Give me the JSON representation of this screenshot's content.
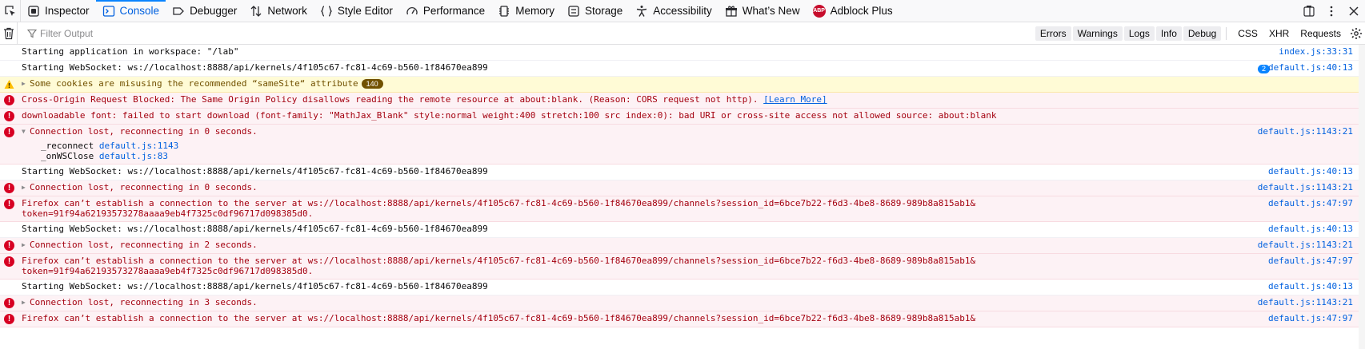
{
  "toolbar": {
    "tabs": [
      {
        "label": "Inspector",
        "icon": "inspector-icon"
      },
      {
        "label": "Console",
        "icon": "console-icon",
        "selected": true
      },
      {
        "label": "Debugger",
        "icon": "debugger-icon"
      },
      {
        "label": "Network",
        "icon": "network-icon"
      },
      {
        "label": "Style Editor",
        "icon": "style-editor-icon"
      },
      {
        "label": "Performance",
        "icon": "performance-icon"
      },
      {
        "label": "Memory",
        "icon": "memory-icon"
      },
      {
        "label": "Storage",
        "icon": "storage-icon"
      },
      {
        "label": "Accessibility",
        "icon": "accessibility-icon"
      },
      {
        "label": "What’s New",
        "icon": "whats-new-icon"
      },
      {
        "label": "Adblock Plus",
        "icon": "adblock-plus-icon"
      }
    ],
    "abp_badge": "ABP"
  },
  "filterbar": {
    "placeholder": "Filter Output",
    "levels": [
      "Errors",
      "Warnings",
      "Logs",
      "Info",
      "Debug"
    ],
    "net_filters": [
      "CSS",
      "XHR",
      "Requests"
    ]
  },
  "messages": [
    {
      "type": "log",
      "text": "Starting application in workspace: \"/lab\"",
      "location": "index.js:33:31"
    },
    {
      "type": "log",
      "text": "Starting WebSocket: ws://localhost:8888/api/kernels/4f105c67-fc81-4c69-b560-1f84670ea899",
      "location": "default.js:40:13",
      "repeat": "2"
    },
    {
      "type": "warn",
      "text": "Some cookies are misusing the recommended “sameSite“ attribute",
      "count": "140"
    },
    {
      "type": "error",
      "text": "Cross-Origin Request Blocked: The Same Origin Policy disallows reading the remote resource at about:blank. (Reason: CORS request not http). ",
      "link": "[Learn More]"
    },
    {
      "type": "error",
      "text": "downloadable font: failed to start download (font-family: \"MathJax_Blank\" style:normal weight:400 stretch:100 src index:0): bad URI or cross-site access not allowed source: about:blank"
    },
    {
      "type": "error",
      "expanded": true,
      "text": "Connection lost, reconnecting in 0 seconds.",
      "location": "default.js:1143:21",
      "stack": [
        {
          "fn": "_reconnect",
          "src": "default.js:1143"
        },
        {
          "fn": "_onWSClose",
          "src": "default.js:83"
        }
      ]
    },
    {
      "type": "log",
      "text": "Starting WebSocket: ws://localhost:8888/api/kernels/4f105c67-fc81-4c69-b560-1f84670ea899",
      "location": "default.js:40:13"
    },
    {
      "type": "error",
      "collapsed": true,
      "text": "Connection lost, reconnecting in 0 seconds.",
      "location": "default.js:1143:21"
    },
    {
      "type": "error",
      "text": "Firefox can’t establish a connection to the server at ws://localhost:8888/api/kernels/4f105c67-fc81-4c69-b560-1f84670ea899/channels?session_id=6bce7b22-f6d3-4be8-8689-989b8a815ab1&\ntoken=91f94a62193573278aaaa9eb4f7325c0df96717d098385d0.",
      "location": "default.js:47:97"
    },
    {
      "type": "log",
      "text": "Starting WebSocket: ws://localhost:8888/api/kernels/4f105c67-fc81-4c69-b560-1f84670ea899",
      "location": "default.js:40:13"
    },
    {
      "type": "error",
      "collapsed": true,
      "text": "Connection lost, reconnecting in 2 seconds.",
      "location": "default.js:1143:21"
    },
    {
      "type": "error",
      "text": "Firefox can’t establish a connection to the server at ws://localhost:8888/api/kernels/4f105c67-fc81-4c69-b560-1f84670ea899/channels?session_id=6bce7b22-f6d3-4be8-8689-989b8a815ab1&\ntoken=91f94a62193573278aaaa9eb4f7325c0df96717d098385d0.",
      "location": "default.js:47:97"
    },
    {
      "type": "log",
      "text": "Starting WebSocket: ws://localhost:8888/api/kernels/4f105c67-fc81-4c69-b560-1f84670ea899",
      "location": "default.js:40:13"
    },
    {
      "type": "error",
      "collapsed": true,
      "text": "Connection lost, reconnecting in 3 seconds.",
      "location": "default.js:1143:21"
    },
    {
      "type": "error",
      "text": "Firefox can’t establish a connection to the server at ws://localhost:8888/api/kernels/4f105c67-fc81-4c69-b560-1f84670ea899/channels?session_id=6bce7b22-f6d3-4be8-8689-989b8a815ab1&",
      "location": "default.js:47:97"
    }
  ]
}
